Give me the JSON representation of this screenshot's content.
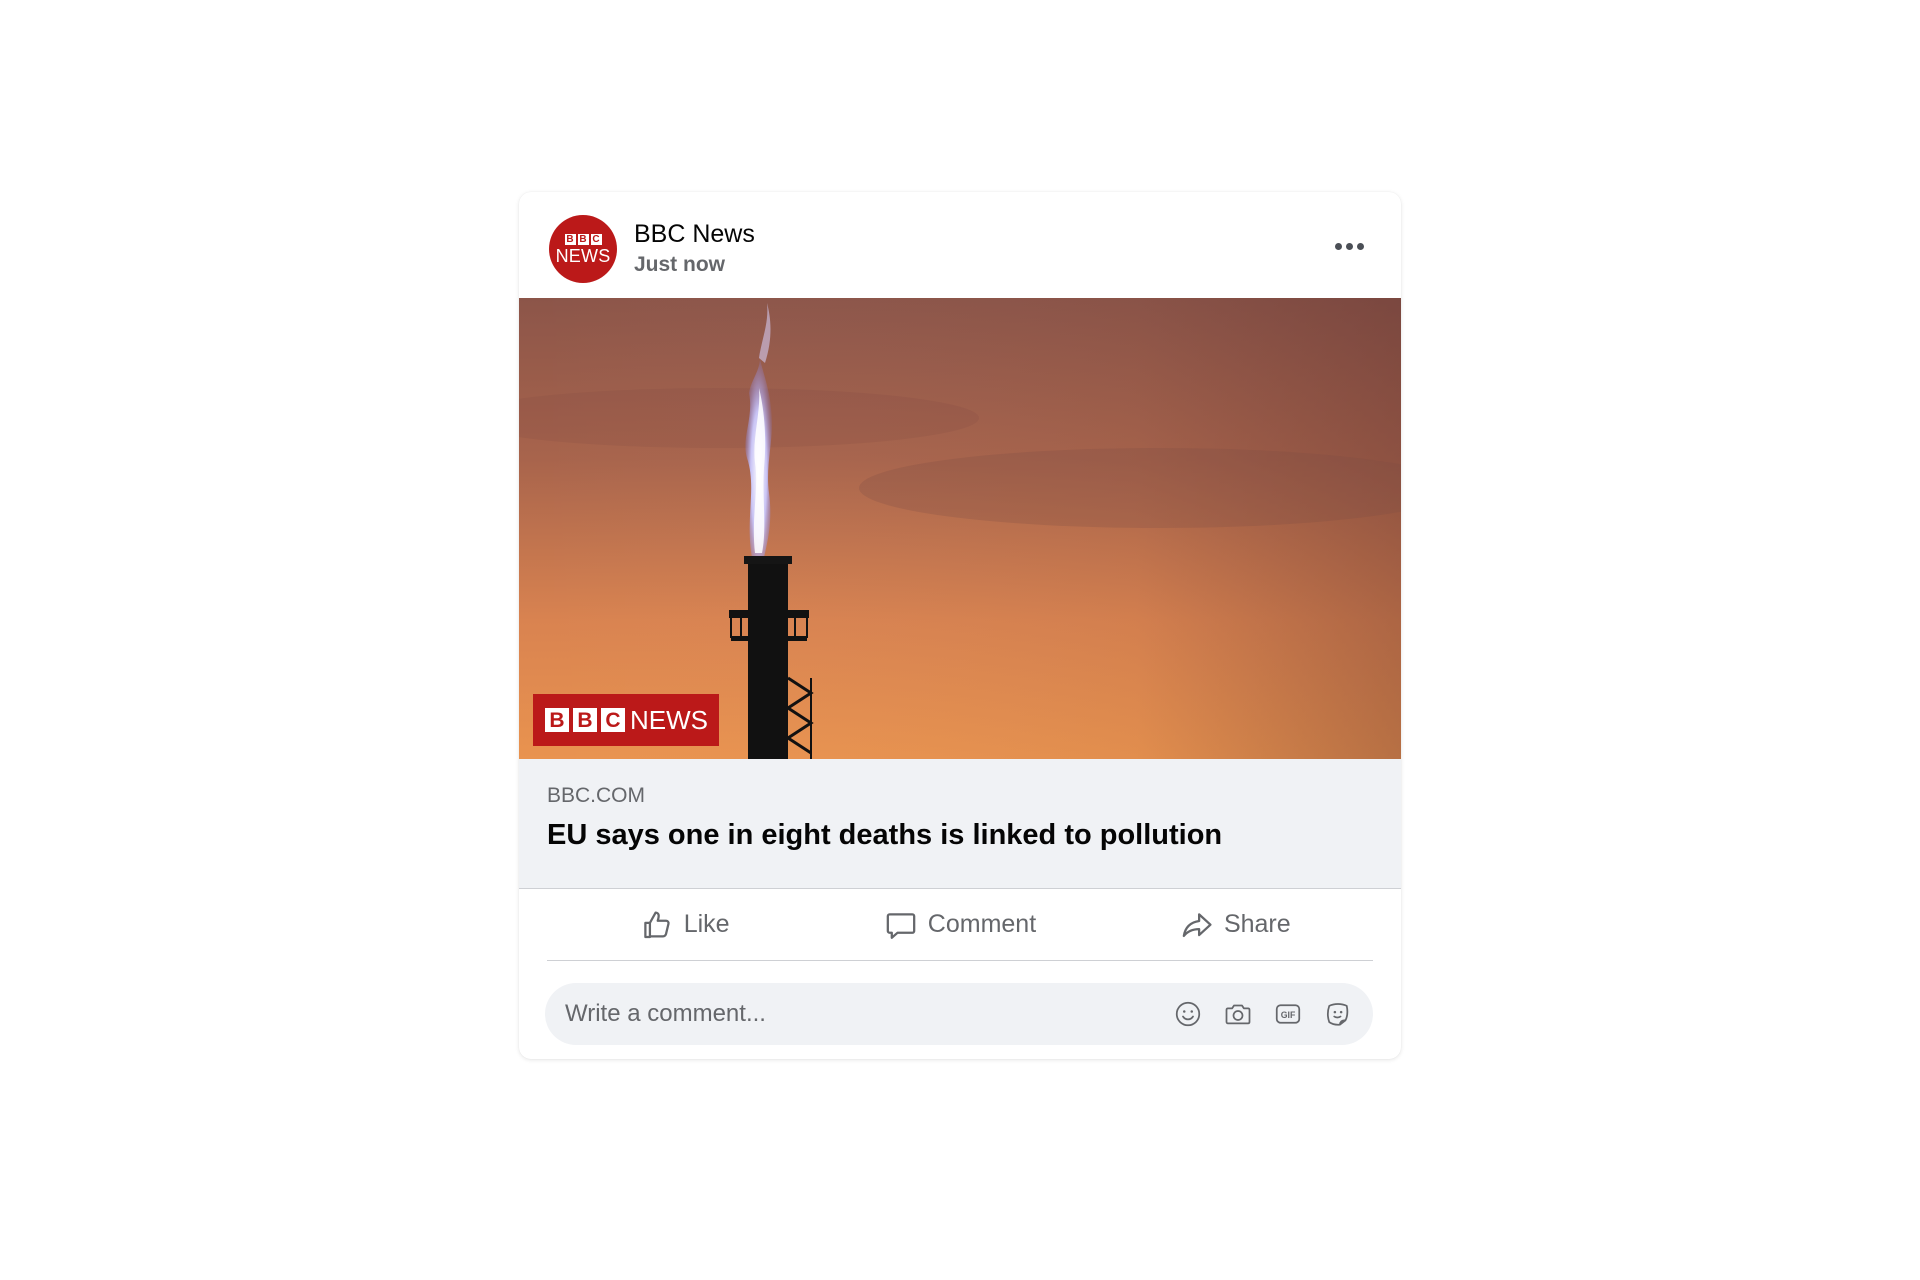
{
  "post": {
    "author": "BBC News",
    "time": "Just now",
    "avatar_top": "BBC",
    "avatar_bottom": "NEWS",
    "more_icon": "more-horizontal-icon"
  },
  "image": {
    "watermark_letters": [
      "B",
      "B",
      "C"
    ],
    "watermark_word": "NEWS"
  },
  "link": {
    "domain": "BBC.COM",
    "headline": "EU says one in eight deaths is linked to pollution"
  },
  "actions": {
    "like_label": "Like",
    "comment_label": "Comment",
    "share_label": "Share"
  },
  "comment_box": {
    "placeholder": "Write a comment...",
    "icons": [
      "emoji-icon",
      "camera-icon",
      "gif-icon",
      "sticker-icon"
    ]
  },
  "colors": {
    "bbc_red": "#bb1919",
    "secondary_text": "#65676b",
    "surface": "#f0f2f5"
  }
}
